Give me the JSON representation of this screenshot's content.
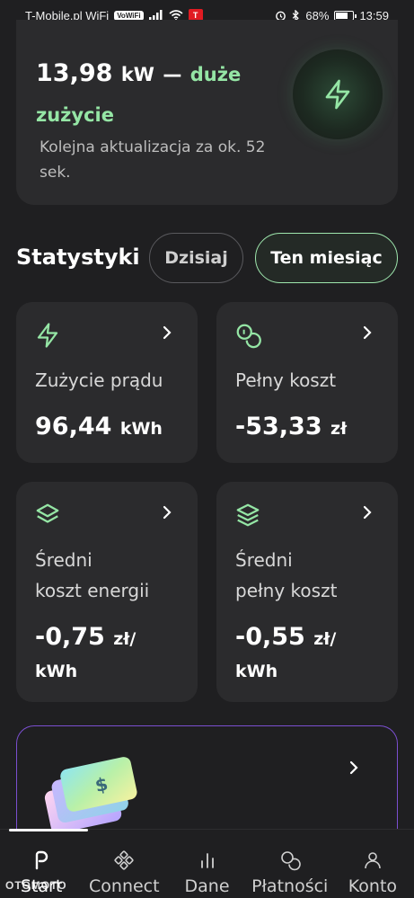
{
  "status_bar": {
    "carrier": "T-Mobile.pl WiFi",
    "volte": "VoWiFi",
    "tesla_badge": "T",
    "battery": "68%",
    "time": "13:59"
  },
  "live": {
    "value": "13,98",
    "unit": "kW",
    "dash": "—",
    "status": "duże zużycie",
    "update_text": "Kolejna aktualizacja za ok. 52 sek.",
    "icon": "lightning-bolt-icon"
  },
  "stats": {
    "title": "Statystyki",
    "filters": [
      "Dzisiaj",
      "Ten miesiąc"
    ],
    "active_filter": "Ten miesiąc",
    "cards": [
      {
        "icon": "lightning-bolt-icon",
        "label": "Zużycie prądu",
        "value": "96,44",
        "unit": "kWh"
      },
      {
        "icon": "coins-icon",
        "label": "Pełny koszt",
        "value": "-53,33",
        "unit": "zł"
      },
      {
        "icon": "layers-icon",
        "label_line1": "Średni",
        "label_line2": "koszt energii",
        "value": "-0,75",
        "unit_line1": "zł/",
        "unit_line2": "kWh"
      },
      {
        "icon": "layers-stack-icon",
        "label_line1": "Średni",
        "label_line2": "pełny koszt",
        "value": "-0,55",
        "unit_line1": "zł/",
        "unit_line2": "kWh"
      }
    ]
  },
  "nav": {
    "items": [
      {
        "label": "Start",
        "icon": "home-p-icon"
      },
      {
        "label": "Connect",
        "icon": "connect-icon"
      },
      {
        "label": "Dane",
        "icon": "bar-chart-icon"
      },
      {
        "label": "Płatności",
        "icon": "coins-icon"
      },
      {
        "label": "Konto",
        "icon": "user-icon"
      }
    ],
    "active": "Start"
  },
  "watermark": "OTOMOTO",
  "colors": {
    "background": "#1f1f21",
    "card": "#2b2b2d",
    "accent_green": "#95e6a5",
    "promo_border": "#7b4fd0"
  }
}
